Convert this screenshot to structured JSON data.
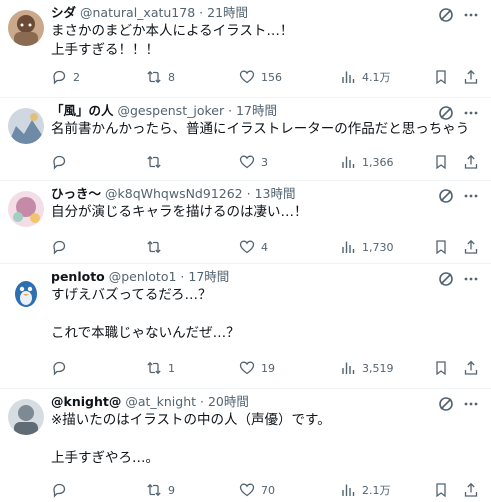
{
  "tweets": [
    {
      "name": "シダ",
      "handle": "@natural_xatu178",
      "time": "21時間",
      "lines": [
        "まさかのまどか本人によるイラスト…！",
        "上手すぎる！！！"
      ],
      "replies": "2",
      "retweets": "8",
      "likes": "156",
      "views": "4.1万",
      "avatar_color": "#8a6b52"
    },
    {
      "name": "「風」の人",
      "handle": "@gespenst_joker",
      "time": "17時間",
      "lines": [
        "名前書かんかったら、普通にイラストレーターの作品だと思っちゃう"
      ],
      "replies": "",
      "retweets": "",
      "likes": "3",
      "views": "1,366",
      "avatar_color": "#6f8aa6"
    },
    {
      "name": "ひっき～",
      "handle": "@k8qWhqwsNd91262",
      "time": "13時間",
      "lines": [
        "自分が演じるキャラを描けるのは凄い…！"
      ],
      "replies": "",
      "retweets": "",
      "likes": "4",
      "views": "1,730",
      "avatar_color": "#e8c3d3"
    },
    {
      "name": "penloto",
      "handle": "@penloto1",
      "time": "17時間",
      "lines": [
        "すげえバズってるだろ…？",
        "",
        "これで本職じゃないんだぜ…？"
      ],
      "replies": "",
      "retweets": "1",
      "likes": "19",
      "views": "3,519",
      "avatar_color": "#2d6fb0"
    },
    {
      "name": "@knight@",
      "handle": "@at_knight",
      "time": "20時間",
      "lines": [
        "※描いたのはイラストの中の人（声優）です。",
        "",
        "上手すぎやろ…。"
      ],
      "replies": "",
      "retweets": "9",
      "likes": "70",
      "views": "2.1万",
      "avatar_color": "#a9b4bd"
    }
  ],
  "separator_dot": "·",
  "colors": {
    "text": "#0f1419",
    "muted": "#536471",
    "border": "#eff3f4"
  }
}
